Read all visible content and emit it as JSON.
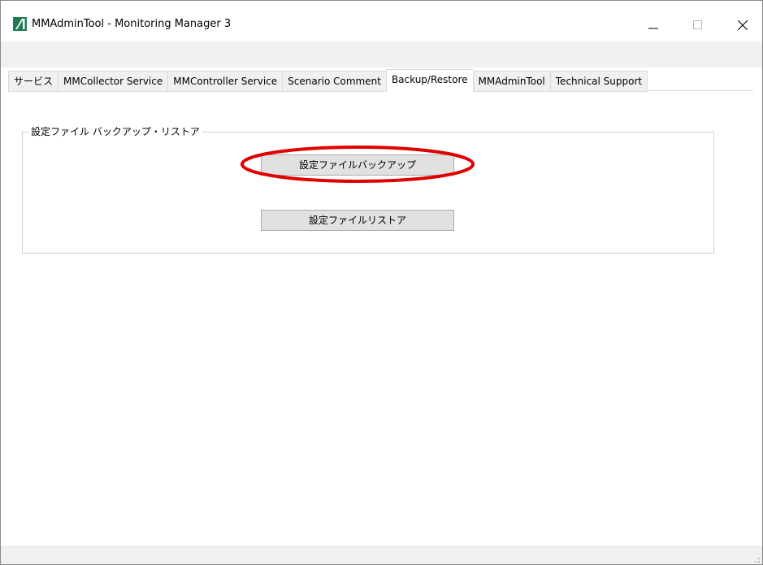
{
  "window": {
    "title": "MMAdminTool - Monitoring Manager 3",
    "icon": "app-logo-icon",
    "controls": [
      "minimize-icon",
      "maximize-icon",
      "close-icon"
    ]
  },
  "tabs": [
    {
      "label": "サービス",
      "active": false
    },
    {
      "label": "MMCollector Service",
      "active": false
    },
    {
      "label": "MMController Service",
      "active": false
    },
    {
      "label": "Scenario Comment",
      "active": false
    },
    {
      "label": "Backup/Restore",
      "active": true
    },
    {
      "label": "MMAdminTool",
      "active": false
    },
    {
      "label": "Technical Support",
      "active": false
    }
  ],
  "group": {
    "title": "設定ファイル バックアップ・リストア",
    "backup_button": "設定ファイルバックアップ",
    "restore_button": "設定ファイルリストア"
  },
  "colors": {
    "highlight": "#e00000",
    "app_icon": "#1f7a52"
  }
}
